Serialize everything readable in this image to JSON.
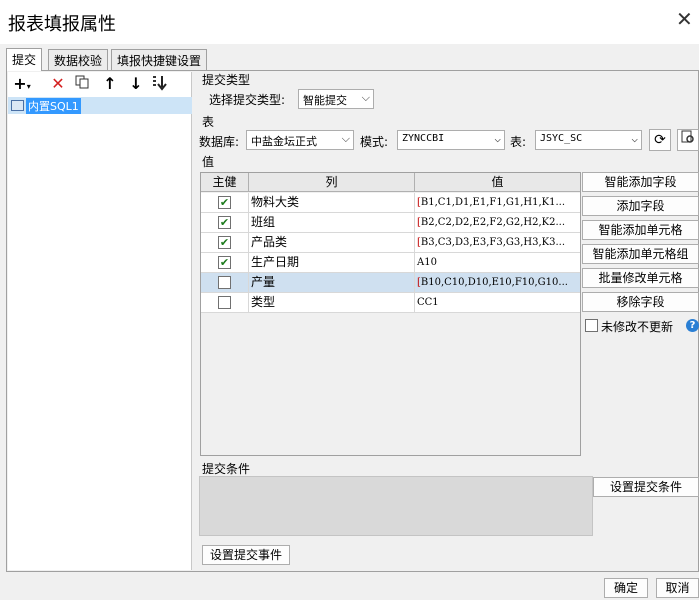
{
  "window": {
    "title": "报表填报属性",
    "close_glyph": "✕"
  },
  "tabs": [
    {
      "label": "提交",
      "active": true
    },
    {
      "label": "数据校验",
      "active": false
    },
    {
      "label": "填报快捷键设置",
      "active": false
    }
  ],
  "tree": {
    "toolbar": [
      "add-icon",
      "delete-icon",
      "copy-icon",
      "move-up-icon",
      "move-down-icon",
      "move-bottom-icon"
    ],
    "items": [
      {
        "label": "内置SQL1",
        "selected": true
      }
    ]
  },
  "submit_type": {
    "section_label": "提交类型",
    "select_label": "选择提交类型:",
    "value": "智能提交"
  },
  "table_section": {
    "section_label": "表",
    "db_label": "数据库:",
    "db_value": "中盐金坛正式",
    "schema_label": "模式:",
    "schema_value": "ZYNCCBI",
    "table_label": "表:",
    "table_value": "JSYC_SC"
  },
  "value_section": {
    "section_label": "值",
    "columns": [
      "主健",
      "列",
      "值"
    ],
    "rows": [
      {
        "key": true,
        "column": "物料大类",
        "value": "[B1,C1,D1,E1,F1,G1,H1,K1...",
        "selected": false
      },
      {
        "key": true,
        "column": "班组",
        "value": "[B2,C2,D2,E2,F2,G2,H2,K2...",
        "selected": false
      },
      {
        "key": true,
        "column": "产品类",
        "value": "[B3,C3,D3,E3,F3,G3,H3,K3...",
        "selected": false
      },
      {
        "key": true,
        "column": "生产日期",
        "value": "A10",
        "selected": false
      },
      {
        "key": false,
        "column": "产量",
        "value": "[B10,C10,D10,E10,F10,G10...",
        "selected": true
      },
      {
        "key": false,
        "column": "类型",
        "value": "CC1",
        "selected": false
      }
    ]
  },
  "side_buttons": [
    "智能添加字段",
    "添加字段",
    "智能添加单元格",
    "智能添加单元格组",
    "批量修改单元格",
    "移除字段"
  ],
  "no_update_label": "未修改不更新",
  "condition": {
    "section_label": "提交条件",
    "button": "设置提交条件"
  },
  "event_button": "设置提交事件",
  "footer": {
    "ok": "确定",
    "cancel": "取消"
  }
}
